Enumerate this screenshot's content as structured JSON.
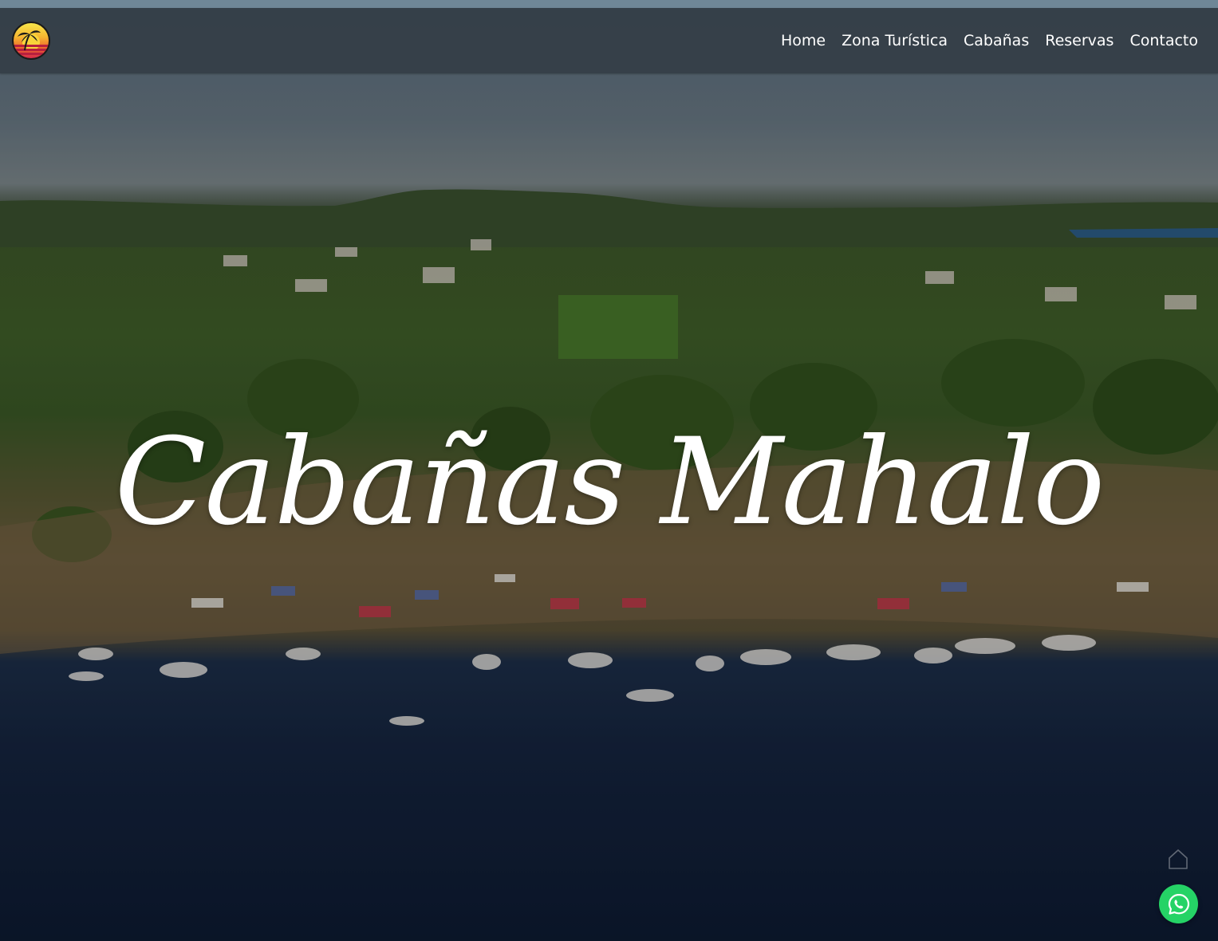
{
  "brand": {
    "logo_icon": "sunset-palm-logo-icon",
    "colors": [
      "#f7e64a",
      "#ee6a2b",
      "#d42a4c"
    ]
  },
  "nav": {
    "items": [
      {
        "label": "Home"
      },
      {
        "label": "Zona Turística"
      },
      {
        "label": "Cabañas"
      },
      {
        "label": "Reservas"
      },
      {
        "label": "Contacto"
      }
    ]
  },
  "hero": {
    "title": "Cabañas Mahalo"
  },
  "widgets": {
    "home_icon": "home-icon",
    "whatsapp_icon": "whatsapp-icon",
    "whatsapp_color": "#25d366"
  }
}
